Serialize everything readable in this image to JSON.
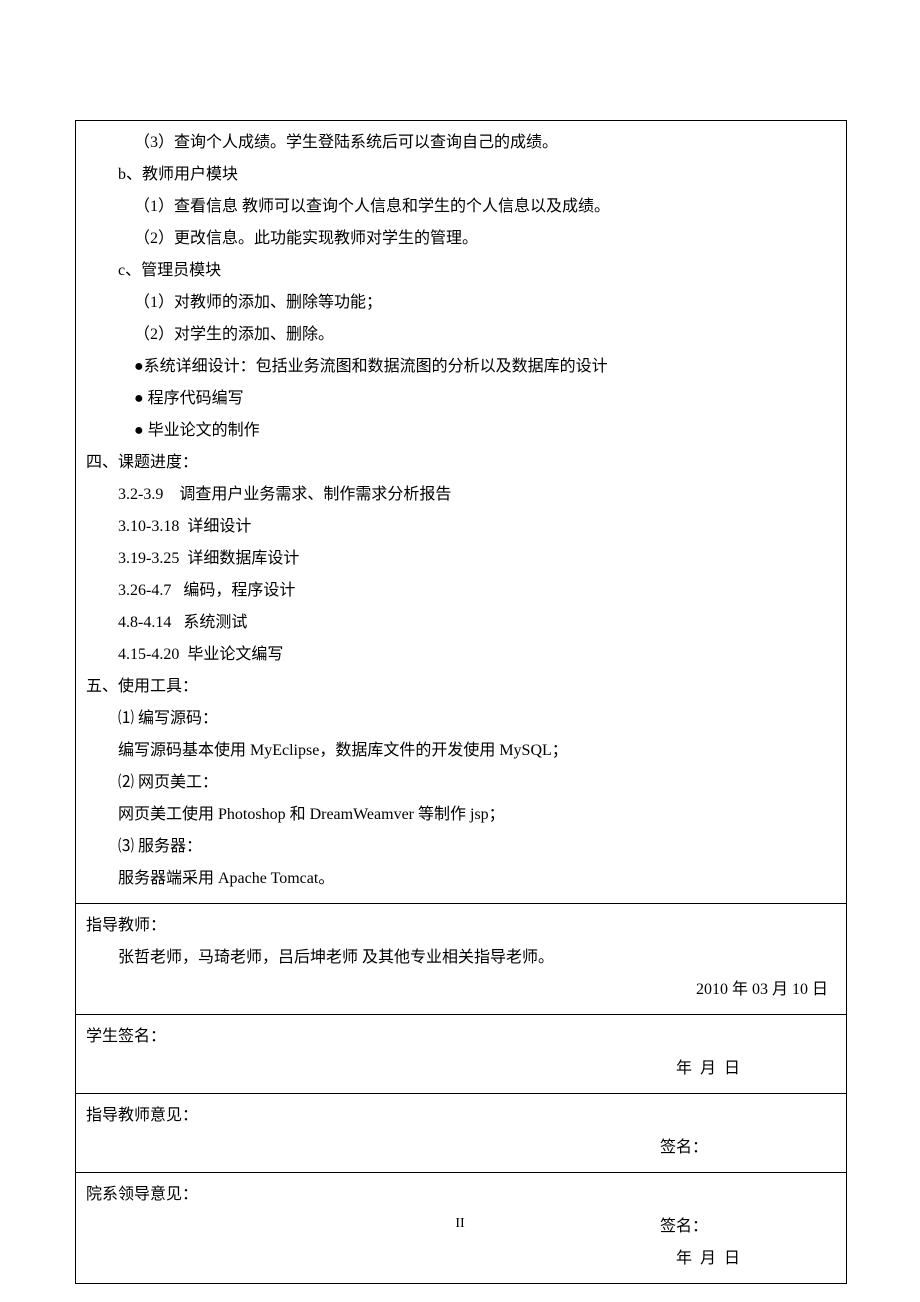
{
  "section1": {
    "l1": "（3）查询个人成绩。学生登陆系统后可以查询自己的成绩。",
    "l2": "b、教师用户模块",
    "l3": "（1）查看信息 教师可以查询个人信息和学生的个人信息以及成绩。",
    "l4": "（2）更改信息。此功能实现教师对学生的管理。",
    "l5": "c、管理员模块",
    "l6": "（1）对教师的添加、删除等功能；",
    "l7": "（2）对学生的添加、删除。",
    "l8": "●系统详细设计：包括业务流图和数据流图的分析以及数据库的设计",
    "l9": "● 程序代码编写",
    "l10": "● 毕业论文的制作",
    "h4": "四、课题进度：",
    "s1": "3.2-3.9    调查用户业务需求、制作需求分析报告",
    "s2": "3.10-3.18  详细设计",
    "s3": "3.19-3.25  详细数据库设计",
    "s4": "3.26-4.7   编码，程序设计",
    "s5": "4.8-4.14   系统测试",
    "s6": "4.15-4.20  毕业论文编写",
    "h5": "五、使用工具：",
    "t1": "⑴ 编写源码：",
    "t2": "编写源码基本使用 MyEclipse，数据库文件的开发使用 MySQL；",
    "t3": "⑵ 网页美工：",
    "t4": "网页美工使用 Photoshop 和 DreamWeamver 等制作 jsp；",
    "t5": "⑶ 服务器：",
    "t6": "服务器端采用 Apache Tomcat。"
  },
  "section2": {
    "label": "指导教师：",
    "names": "张哲老师，马琦老师，吕后坤老师 及其他专业相关指导老师。",
    "date": "2010 年 03 月 10 日"
  },
  "section3": {
    "label": "学生签名：",
    "date": "年  月  日"
  },
  "section4": {
    "label": "指导教师意见：",
    "sign": "签名："
  },
  "section5": {
    "label": "院系领导意见：",
    "sign": "签名：",
    "date": "年  月  日"
  },
  "pagenum": "II"
}
